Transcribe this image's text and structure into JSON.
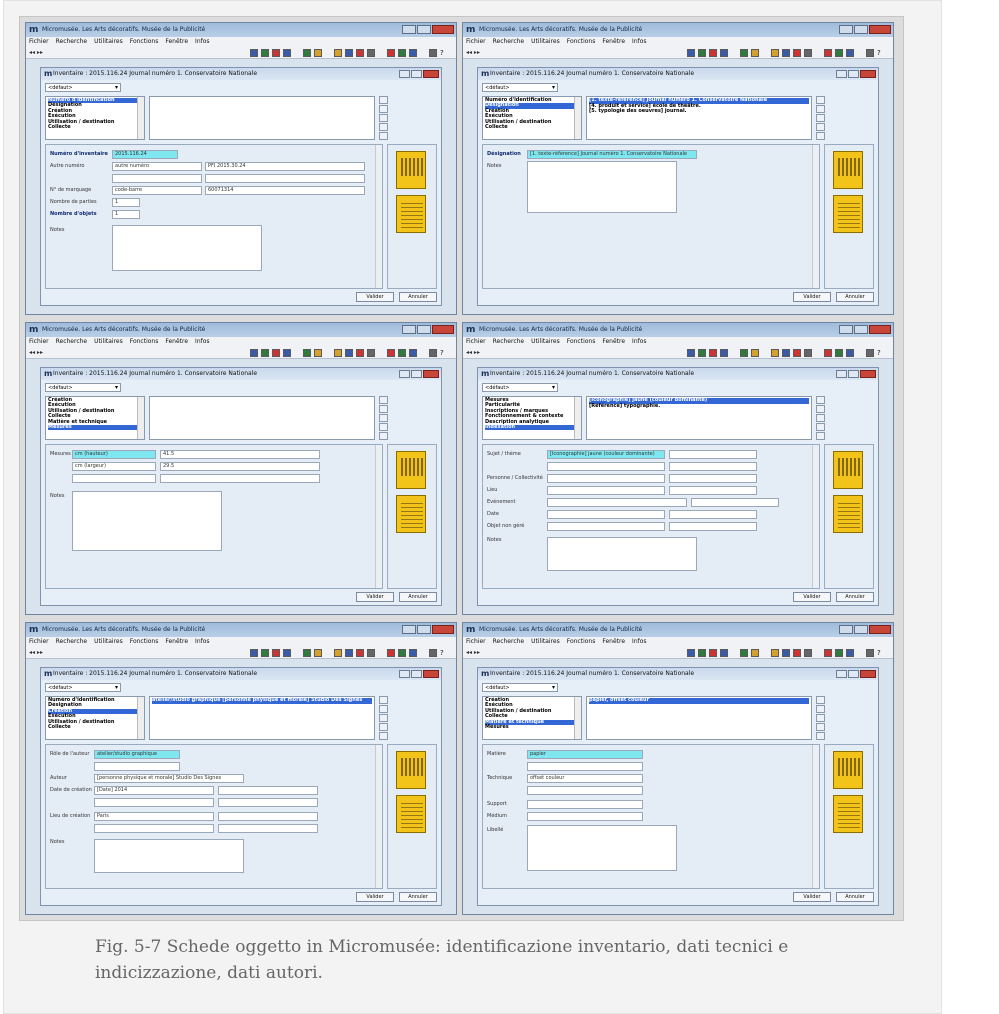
{
  "window": {
    "title": "Micromusée. Les Arts décoratifs. Musée de la Publicité",
    "menu": [
      "Fichier",
      "Recherche",
      "Utilitaires",
      "Fonctions",
      "Fenêtre",
      "Infos"
    ],
    "nav": "◂◂ ▸▸",
    "inner_title": "Inventaire : 2015.116.24 Journal numéro 1. Conservatoire Nationale",
    "preset": "<défaut>",
    "validate": "Valider",
    "cancel": "Annuler"
  },
  "screens": [
    {
      "sections": [
        "Numéro d'identification",
        "Désignation",
        "Création",
        "Exécution",
        "Utilisation / destination",
        "Collecte"
      ],
      "selected_section": 0,
      "values": [],
      "fields": {
        "r1_label": "Numéro d'inventaire",
        "r1_v1": "2015.116.24",
        "r2_label": "Autre numéro",
        "r2_v1": "autre numéro",
        "r2_v2": "PFI 2015.30.24",
        "r3_label": "N° de marquage",
        "r3_v1": "code-barre",
        "r3_v2": "60071314",
        "r4_label": "Nombre de parties",
        "r4_v1": "1",
        "r5_label": "Nombre d'objets",
        "r5_v1": "1",
        "notes_label": "Notes"
      }
    },
    {
      "sections": [
        "Numéro d'identification",
        "Désignation",
        "Création",
        "Exécution",
        "Utilisation / destination",
        "Collecte"
      ],
      "selected_section": 1,
      "values": [
        "[1. texte-référence] Journal numéro 1. Conservatoire Nationale",
        "[4. produit et service] école de théâtre.",
        "[5. typologie des oeuvres] journal."
      ],
      "fields": {
        "r1_label": "Désignation",
        "r1_v1": "[1. texte-référence] Journal numéro 1. Conservatoire Nationale",
        "notes_label": "Notes"
      }
    },
    {
      "sections": [
        "Création",
        "Exécution",
        "Utilisation / destination",
        "Collecte",
        "Matière et technique",
        "Mesures"
      ],
      "selected_section": 5,
      "values": [],
      "fields": {
        "r1_label": "Mesures",
        "r1_v1": "cm (hauteur)",
        "r1_v2": "41.5",
        "r2_v1": "cm (largeur)",
        "r2_v2": "29.5",
        "notes_label": "Notes"
      }
    },
    {
      "sections": [
        "Mesures",
        "Particularité",
        "Inscriptions / marques",
        "Fonctionnement & contexte",
        "Description analytique",
        "Indexation"
      ],
      "selected_section": 5,
      "values": [
        "[Iconographie] jaune (couleur dominante)",
        "[Référence] typographie."
      ],
      "fields": {
        "r1_label": "Sujet / thème",
        "r1_v1": "[Iconographie] jaune (couleur dominante)",
        "r2_label": "Personne / Collectivité",
        "r3_label": "Lieu",
        "r4_label": "Evénement",
        "r5_label": "Date",
        "r6_label": "Objet non géré",
        "notes_label": "Notes"
      }
    },
    {
      "sections": [
        "Numéro d'identification",
        "Désignation",
        "Création",
        "Exécution",
        "Utilisation / destination",
        "Collecte"
      ],
      "selected_section": 2,
      "values": [
        "atelier/studio graphique  [personne physique et morale] Studio Des Signes"
      ],
      "fields": {
        "r1_label": "Rôle de l'auteur",
        "r1_v1": "atelier/studio graphique",
        "r2_label": "Auteur",
        "r2_v1": "[personne physique et morale] Studio Des Signes",
        "r3_label": "Date de création",
        "r3_v1": "[Date] 2014",
        "r4_label": "Lieu de création",
        "r4_v1": "Paris",
        "notes_label": "Notes"
      }
    },
    {
      "sections": [
        "Création",
        "Exécution",
        "Utilisation / destination",
        "Collecte",
        "Matière et technique",
        "Mesures"
      ],
      "selected_section": 4,
      "values": [
        "papier, offset couleur"
      ],
      "fields": {
        "r1_label": "Matière",
        "r1_v1": "papier",
        "r2_label": "Technique",
        "r2_v1": "offset couleur",
        "r3_label": "Support",
        "r4_label": "Médium",
        "r5_label": "Libellé"
      }
    }
  ],
  "caption": "Fig. 5-7 Schede oggetto in Micromusée: identificazione inventario, dati tecnici e indicizzazione, dati autori."
}
